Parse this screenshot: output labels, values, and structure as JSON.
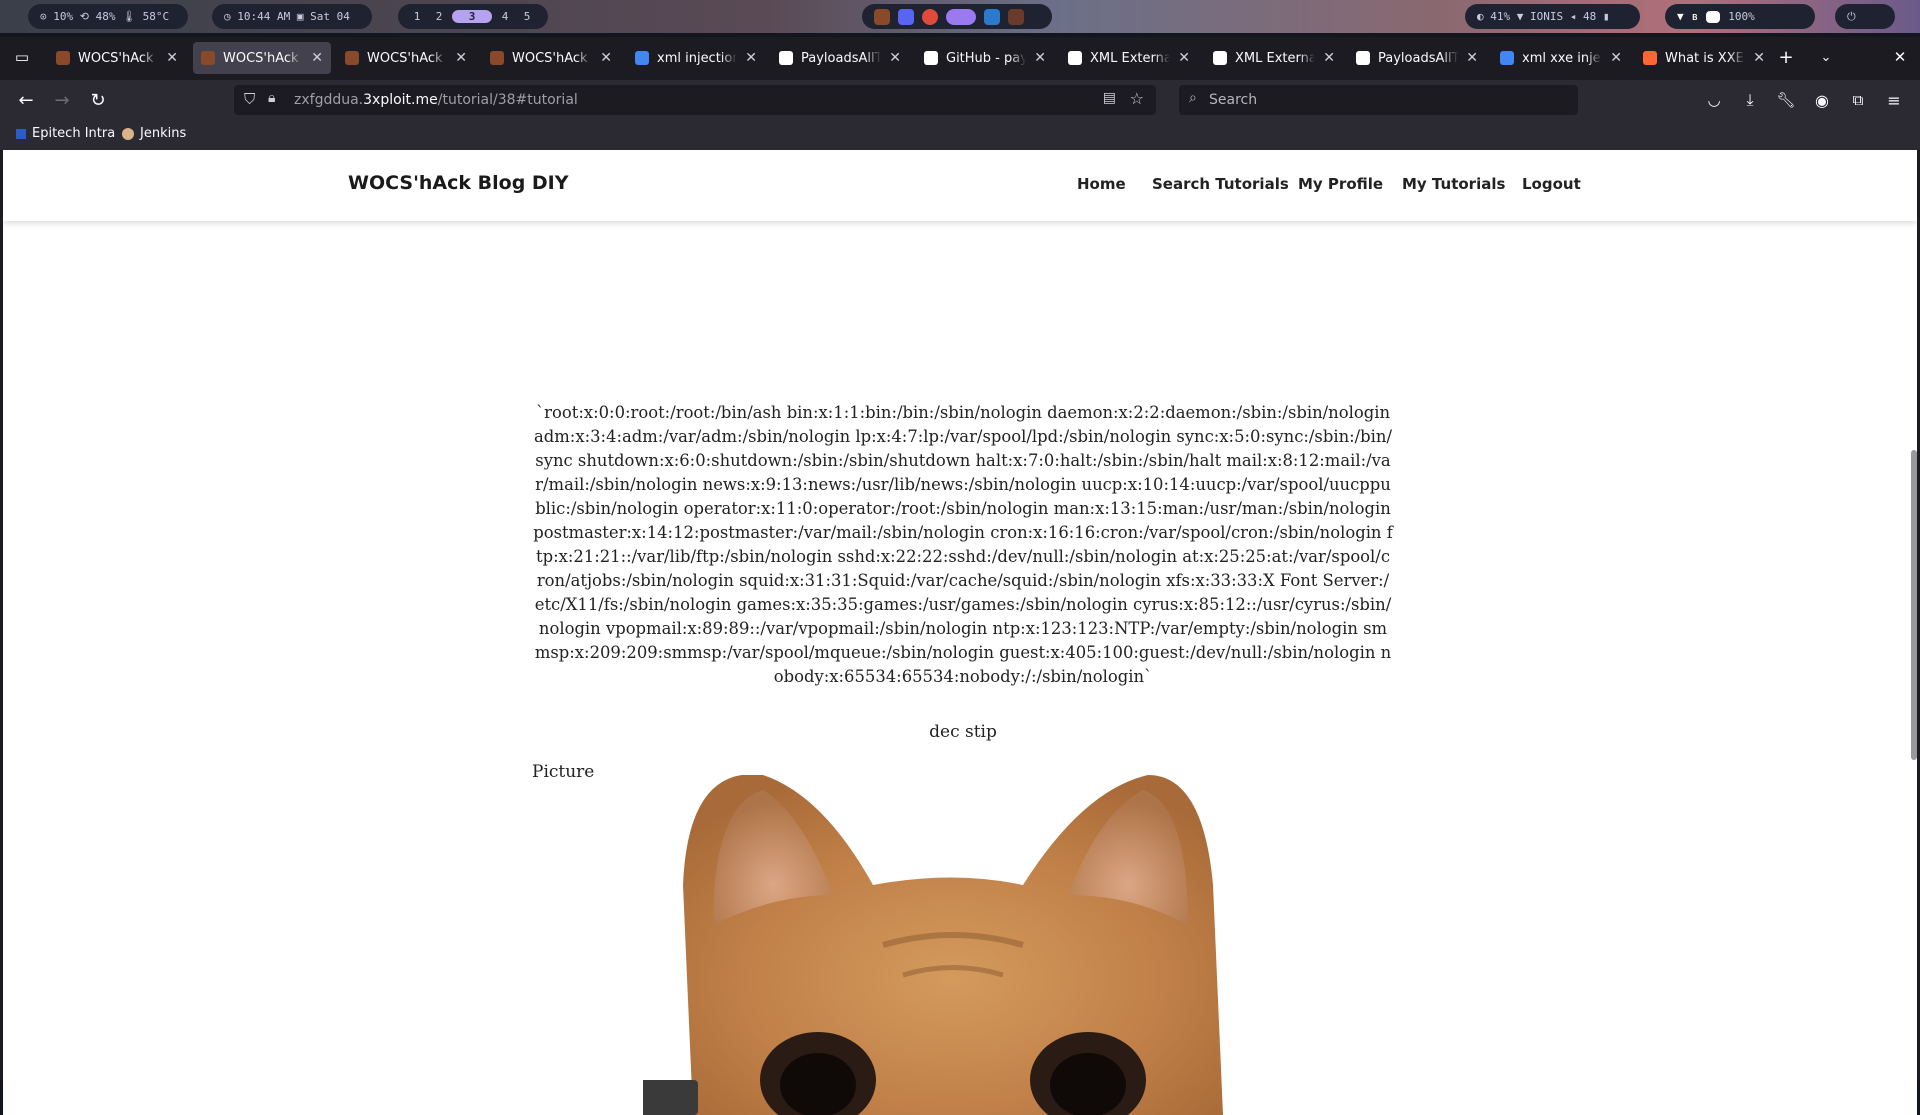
{
  "system_bar": {
    "stats": "⊙ 10%  ⟲ 48%  🌡 58°C",
    "clock": "◷ 10:44 AM  ▣ Sat 04",
    "workspaces": [
      "1",
      "2",
      "3",
      "4",
      "5"
    ],
    "active_workspace": "3",
    "status": "◐ 41%  ▼ IONIS  ◂ 48  ▮",
    "battery": "100%"
  },
  "tabs": [
    {
      "title": "WOCS'hAck Blog DIY",
      "icon": "site-favicon",
      "color": "#8a4a2a",
      "active": false
    },
    {
      "title": "WOCS'hAck Blog DIY",
      "icon": "site-favicon",
      "color": "#8a4a2a",
      "active": true
    },
    {
      "title": "WOCS'hAck Blog DIY",
      "icon": "site-favicon",
      "color": "#8a4a2a",
      "active": false
    },
    {
      "title": "WOCS'hAck Blog DIY",
      "icon": "site-favicon",
      "color": "#8a4a2a",
      "active": false
    },
    {
      "title": "xml injection payload",
      "icon": "google-favicon",
      "color": "#4285f4",
      "active": false
    },
    {
      "title": "PayloadsAllTheThings",
      "icon": "github-favicon",
      "color": "#ffffff",
      "active": false
    },
    {
      "title": "GitHub - payloadbox",
      "icon": "github-favicon",
      "color": "#ffffff",
      "active": false
    },
    {
      "title": "XML External Entity",
      "icon": "owasp-favicon",
      "color": "#ffffff",
      "active": false
    },
    {
      "title": "XML External Entity",
      "icon": "owasp-favicon",
      "color": "#ffffff",
      "active": false
    },
    {
      "title": "PayloadsAllTheThings",
      "icon": "github-favicon",
      "color": "#ffffff",
      "active": false
    },
    {
      "title": "xml xxe injection",
      "icon": "google-favicon",
      "color": "#4285f4",
      "active": false
    },
    {
      "title": "What is XXE (XML",
      "icon": "portswigger-favicon",
      "color": "#ff6633",
      "active": false
    }
  ],
  "url": {
    "prefix": "zxfgddua.",
    "host": "3xploit.me",
    "path": "/tutorial/38#tutorial"
  },
  "search_placeholder": "Search",
  "bookmarks": [
    "Epitech Intra",
    "Jenkins"
  ],
  "site": {
    "brand": "WOCS'hAck Blog DIY",
    "nav": [
      "Home",
      "Search Tutorials",
      "My Profile",
      "My Tutorials",
      "Logout"
    ]
  },
  "content": {
    "passwd": "`root:x:0:0:root:/root:/bin/ash bin:x:1:1:bin:/bin:/sbin/nologin daemon:x:2:2:daemon:/sbin:/sbin/nologin adm:x:3:4:adm:/var/adm:/sbin/nologin lp:x:4:7:lp:/var/spool/lpd:/sbin/nologin sync:x:5:0:sync:/sbin:/bin/sync shutdown:x:6:0:shutdown:/sbin:/sbin/shutdown halt:x:7:0:halt:/sbin:/sbin/halt mail:x:8:12:mail:/var/mail:/sbin/nologin news:x:9:13:news:/usr/lib/news:/sbin/nologin uucp:x:10:14:uucp:/var/spool/uucppublic:/sbin/nologin operator:x:11:0:operator:/root:/sbin/nologin man:x:13:15:man:/usr/man:/sbin/nologin postmaster:x:14:12:postmaster:/var/mail:/sbin/nologin cron:x:16:16:cron:/var/spool/cron:/sbin/nologin ftp:x:21:21::/var/lib/ftp:/sbin/nologin sshd:x:22:22:sshd:/dev/null:/sbin/nologin at:x:25:25:at:/var/spool/cron/atjobs:/sbin/nologin squid:x:31:31:Squid:/var/cache/squid:/sbin/nologin xfs:x:33:33:X Font Server:/etc/X11/fs:/sbin/nologin games:x:35:35:games:/usr/games:/sbin/nologin cyrus:x:85:12::/usr/cyrus:/sbin/nologin vpopmail:x:89:89::/var/vpopmail:/sbin/nologin ntp:x:123:123:NTP:/var/empty:/sbin/nologin smmsp:x:209:209:smmsp:/var/spool/mqueue:/sbin/nologin guest:x:405:100:guest:/dev/null:/sbin/nologin nobody:x:65534:65534:nobody:/:/sbin/nologin`",
    "description": "dec stip",
    "picture_label": "Picture"
  }
}
